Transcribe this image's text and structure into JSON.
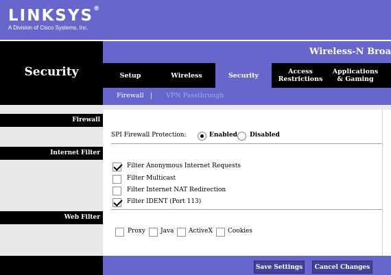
{
  "header": {
    "logo_text": "LINKSYS",
    "logo_mark": "®",
    "tagline": "A Division of Cisco Systems, Inc.",
    "product": "Wireless-N Broa"
  },
  "section_title": "Security",
  "tabs": [
    {
      "label": "Setup",
      "active": false
    },
    {
      "label": "Wireless",
      "active": false
    },
    {
      "label": "Security",
      "active": true
    },
    {
      "label": "Access Restrictions",
      "active": false
    },
    {
      "label": "Applications & Gaming",
      "active": false
    }
  ],
  "subtabs": {
    "firewall": "Firewall",
    "separator": "|",
    "vpn": "VPN Passthrough"
  },
  "sections": {
    "firewall": "Firewall",
    "internet_filter": "Internet Filter",
    "web_filter": "Web Filter"
  },
  "spi": {
    "label": "SPI Firewall Protection:",
    "enabled_label": "Enabled",
    "disabled_label": "Disabled",
    "selected": "Enabled"
  },
  "internet_filters": [
    {
      "label": "Filter Anonymous Internet Requests",
      "checked": true
    },
    {
      "label": "Filter Multicast",
      "checked": false
    },
    {
      "label": "Filter Internet NAT Redirection",
      "checked": false
    },
    {
      "label": "Filter IDENT (Port 113)",
      "checked": true
    }
  ],
  "web_filters": [
    {
      "label": "Proxy",
      "checked": false
    },
    {
      "label": "Java",
      "checked": false
    },
    {
      "label": "ActiveX",
      "checked": false
    },
    {
      "label": "Cookies",
      "checked": false
    }
  ],
  "buttons": {
    "save": "Save Settings",
    "cancel": "Cancel Changes"
  },
  "colors": {
    "brand_purple": "#6666cc",
    "button_dark": "#424299"
  }
}
